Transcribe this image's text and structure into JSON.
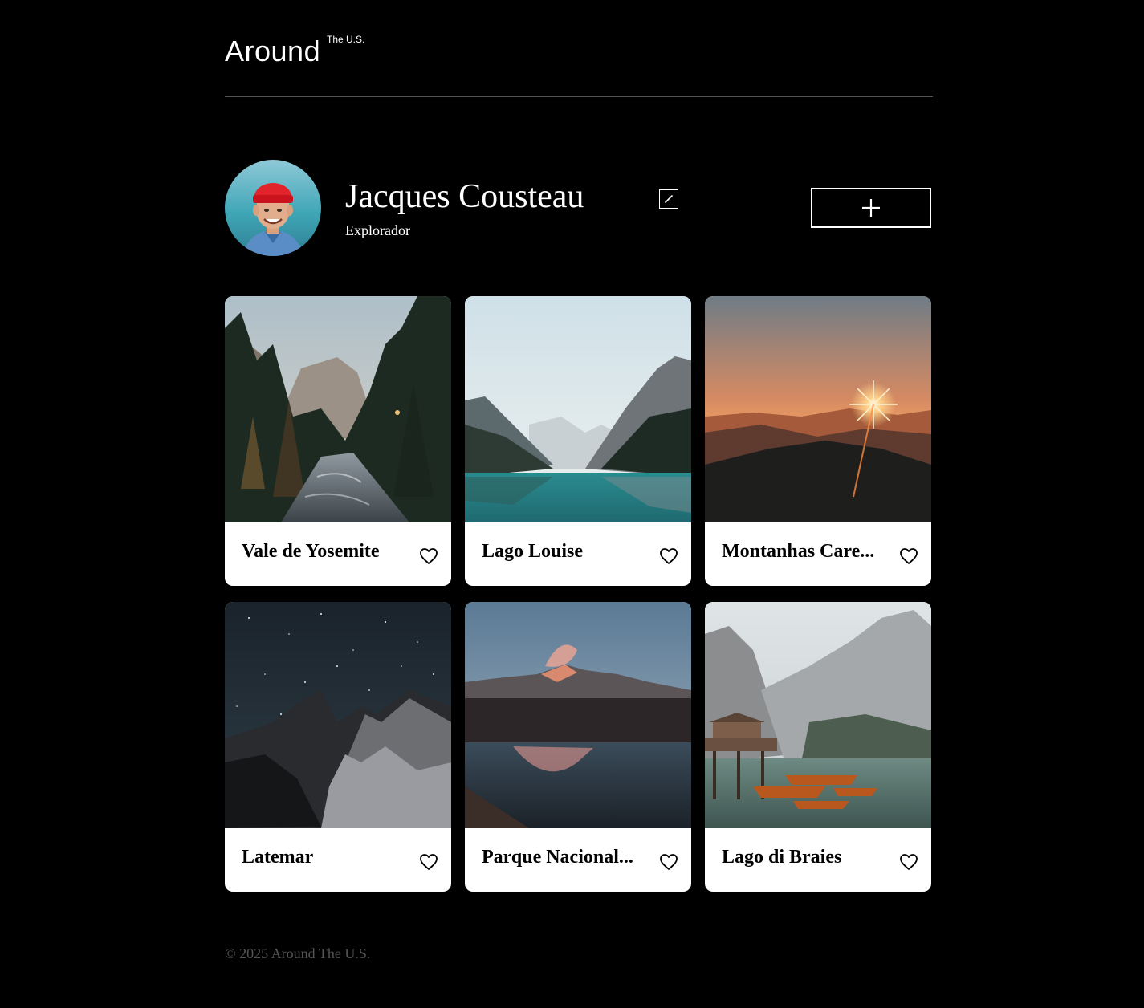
{
  "header": {
    "logo_main": "Around",
    "logo_sup": "The U.S."
  },
  "profile": {
    "name": "Jacques Cousteau",
    "job": "Explorador"
  },
  "cards": [
    {
      "title": "Vale de Yosemite"
    },
    {
      "title": "Lago Louise"
    },
    {
      "title": "Montanhas Care..."
    },
    {
      "title": "Latemar"
    },
    {
      "title": "Parque Nacional..."
    },
    {
      "title": "Lago di Braies"
    }
  ],
  "footer": {
    "copyright": "© 2025 Around The U.S."
  },
  "icons": {
    "edit": "pencil-icon",
    "add": "plus-icon",
    "like": "heart-outline-icon"
  }
}
